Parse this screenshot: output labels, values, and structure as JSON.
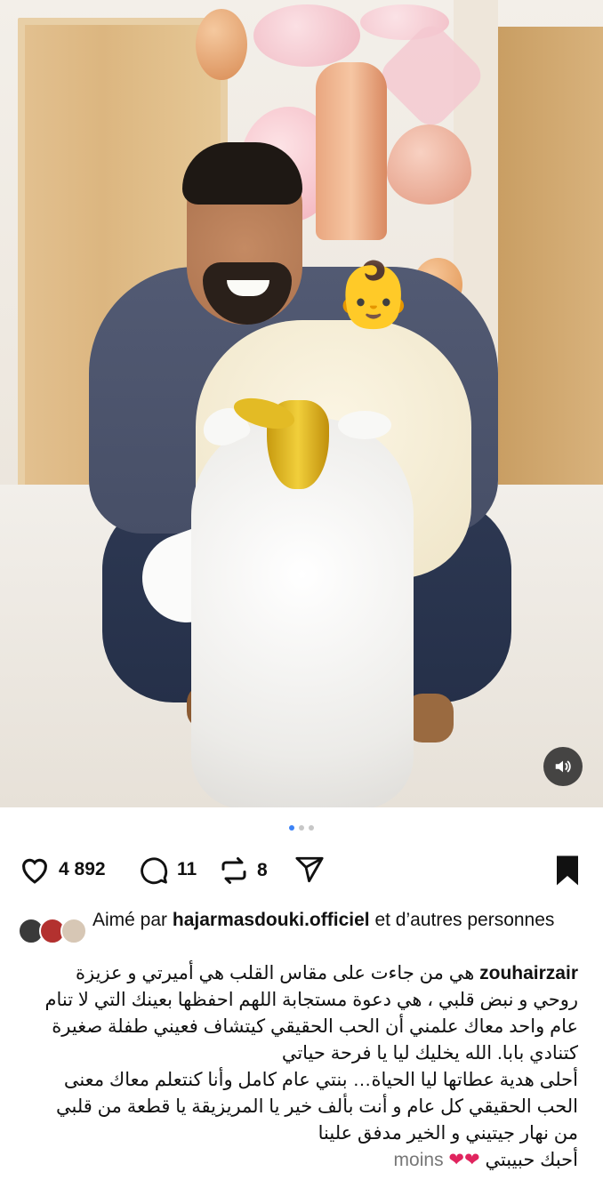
{
  "post": {
    "media_count": 3,
    "active_index": 0,
    "sound_icon": "speaker-icon"
  },
  "actions": {
    "like_count": "4 892",
    "comment_count": "11",
    "repost_count": "8",
    "icons": [
      "heart-icon",
      "comment-icon",
      "repost-icon",
      "share-icon",
      "bookmark-icon"
    ]
  },
  "likes": {
    "prefix": "Aimé par",
    "user": "hajarmasdouki.officiel",
    "suffix": "et d’autres personnes"
  },
  "caption": {
    "username": "zouhairzair",
    "line1": "هي من جاءت على مقاس القلب هي أميرتي و عزيزة",
    "line2": "روحي و نبض قلبي ، هي دعوة مستجابة اللهم احفظها بعينك التي لا تنام",
    "line3": "عام واحد معاك علمني أن الحب الحقيقي كيتشاف فعيني طفلة صغيرة",
    "line4": "كتنادي بابا. الله يخليك ليا يا فرحة حياتي",
    "line5": "أحلى هدية عطاتها ليا الحياة… بنتي عام كامل وأنا كنتعلم معاك معنى",
    "line6": "الحب الحقيقي كل عام و أنت بألف خير يا المريزيقة يا قطعة من قلبي",
    "line7": "من نهار جيتيني و الخير مدفق علينا",
    "line8": "أحبك حبيبتي",
    "more_label": "moins",
    "heart_color": "#e0245e"
  }
}
